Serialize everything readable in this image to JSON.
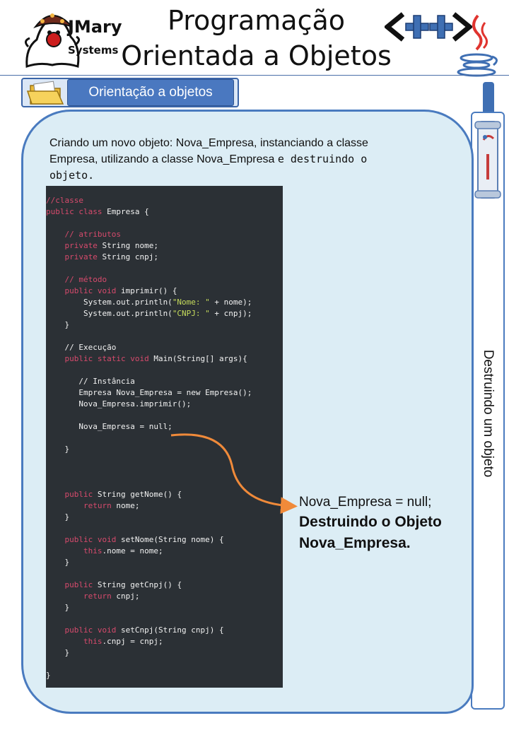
{
  "header": {
    "brand": "JMary",
    "brand_sub": "Systems",
    "title_line1": "Programação",
    "title_line2": "Orientada a Objetos",
    "cpp_logo_icon": "cpp-logo-icon",
    "java_logo_icon": "java-cup-icon"
  },
  "section": {
    "label": "Orientação a objetos",
    "icon": "folder-icon"
  },
  "sidebar": {
    "label": "Destruindo um objeto",
    "icon": "scroll-icon"
  },
  "intro": {
    "part1": "Criando um novo objeto: Nova_Empresa, instanciando a classe Empresa, utilizando a classe Nova_Empresa ",
    "part2": "e destruindo o objeto."
  },
  "code": {
    "lines": [
      [
        {
          "t": "//classe",
          "c": "comment"
        }
      ],
      [
        {
          "t": "public class",
          "c": "keyword"
        },
        {
          "t": " Empresa {",
          "c": "plain"
        }
      ],
      [],
      [
        {
          "t": "    // atributos",
          "c": "comment"
        }
      ],
      [
        {
          "t": "    private",
          "c": "keyword"
        },
        {
          "t": " String nome;",
          "c": "plain"
        }
      ],
      [
        {
          "t": "    private",
          "c": "keyword"
        },
        {
          "t": " String cnpj;",
          "c": "plain"
        }
      ],
      [],
      [
        {
          "t": "    // método",
          "c": "comment"
        }
      ],
      [
        {
          "t": "    public void",
          "c": "keyword"
        },
        {
          "t": " imprimir() {",
          "c": "plain"
        }
      ],
      [
        {
          "t": "        System.out.println(",
          "c": "plain"
        },
        {
          "t": "\"Nome: \"",
          "c": "string"
        },
        {
          "t": " + nome);",
          "c": "plain"
        }
      ],
      [
        {
          "t": "        System.out.println(",
          "c": "plain"
        },
        {
          "t": "\"CNPJ: \"",
          "c": "string"
        },
        {
          "t": " + cnpj);",
          "c": "plain"
        }
      ],
      [
        {
          "t": "    }",
          "c": "plain"
        }
      ],
      [],
      [
        {
          "t": "    // Execução",
          "c": "plain"
        }
      ],
      [
        {
          "t": "    public static void",
          "c": "keyword"
        },
        {
          "t": " Main(String[] args){",
          "c": "plain"
        }
      ],
      [],
      [
        {
          "t": "       // Instância",
          "c": "plain"
        }
      ],
      [
        {
          "t": "       Empresa Nova_Empresa = new Empresa();",
          "c": "plain"
        }
      ],
      [
        {
          "t": "       Nova_Empresa.imprimir();",
          "c": "plain"
        }
      ],
      [],
      [
        {
          "t": "       Nova_Empresa = null;",
          "c": "plain"
        }
      ],
      [],
      [
        {
          "t": "    }",
          "c": "plain"
        }
      ],
      [],
      [],
      [],
      [
        {
          "t": "    public",
          "c": "keyword"
        },
        {
          "t": " String getNome() {",
          "c": "plain"
        }
      ],
      [
        {
          "t": "        return",
          "c": "keyword"
        },
        {
          "t": " nome;",
          "c": "plain"
        }
      ],
      [
        {
          "t": "    }",
          "c": "plain"
        }
      ],
      [],
      [
        {
          "t": "    public void",
          "c": "keyword"
        },
        {
          "t": " setNome(String nome) {",
          "c": "plain"
        }
      ],
      [
        {
          "t": "        this",
          "c": "keyword"
        },
        {
          "t": ".nome = nome;",
          "c": "plain"
        }
      ],
      [
        {
          "t": "    }",
          "c": "plain"
        }
      ],
      [],
      [
        {
          "t": "    public",
          "c": "keyword"
        },
        {
          "t": " String getCnpj() {",
          "c": "plain"
        }
      ],
      [
        {
          "t": "        return",
          "c": "keyword"
        },
        {
          "t": " cnpj;",
          "c": "plain"
        }
      ],
      [
        {
          "t": "    }",
          "c": "plain"
        }
      ],
      [],
      [
        {
          "t": "    public void",
          "c": "keyword"
        },
        {
          "t": " setCnpj(String cnpj) {",
          "c": "plain"
        }
      ],
      [
        {
          "t": "        this",
          "c": "keyword"
        },
        {
          "t": ".cnpj = cnpj;",
          "c": "plain"
        }
      ],
      [
        {
          "t": "    }",
          "c": "plain"
        }
      ],
      [],
      [
        {
          "t": "}",
          "c": "plain"
        }
      ]
    ]
  },
  "callout": {
    "line1": "Nova_Empresa = null;",
    "line2": "Destruindo o Objeto",
    "line3": "Nova_Empresa."
  },
  "colors": {
    "panel_bg": "#dcedf5",
    "panel_border": "#4a7bbf",
    "tab_bg": "#4a78c0",
    "code_bg": "#2b3035",
    "code_keyword": "#d64a6c",
    "code_string": "#c6dc5c",
    "arrow": "#f08a3a"
  }
}
